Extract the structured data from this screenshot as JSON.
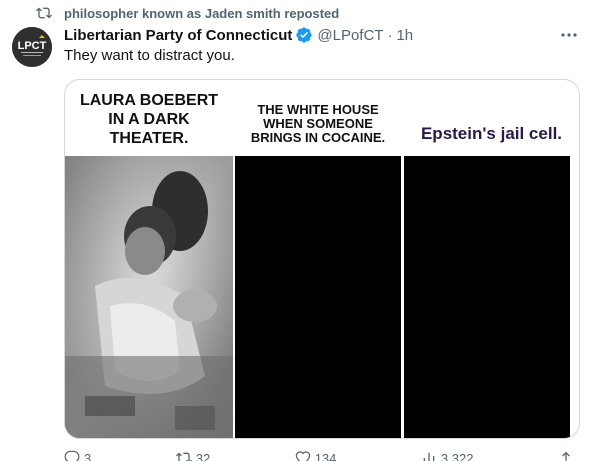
{
  "repost": {
    "text": "philosopher known as Jaden smith reposted"
  },
  "author": {
    "display_name": "Libertarian Party of Connecticut",
    "handle": "@LPofCT",
    "separator": "·",
    "time": "1h",
    "avatar_text": "LPCT"
  },
  "tweet": {
    "text": "They want to distract you."
  },
  "meme": {
    "panels": [
      {
        "caption": "LAURA BOEBERT IN A DARK THEATER."
      },
      {
        "caption": "THE WHITE HOUSE WHEN SOMEONE BRINGS IN COCAINE."
      },
      {
        "caption": "Epstein's jail cell."
      }
    ]
  },
  "actions": {
    "replies": "3",
    "reposts": "32",
    "likes": "134",
    "views": "3,322"
  },
  "colors": {
    "secondary_text": "#536471",
    "verified_blue": "#1d9bf0",
    "border": "#cfd9de",
    "epstein_caption": "#2a1a4a"
  }
}
